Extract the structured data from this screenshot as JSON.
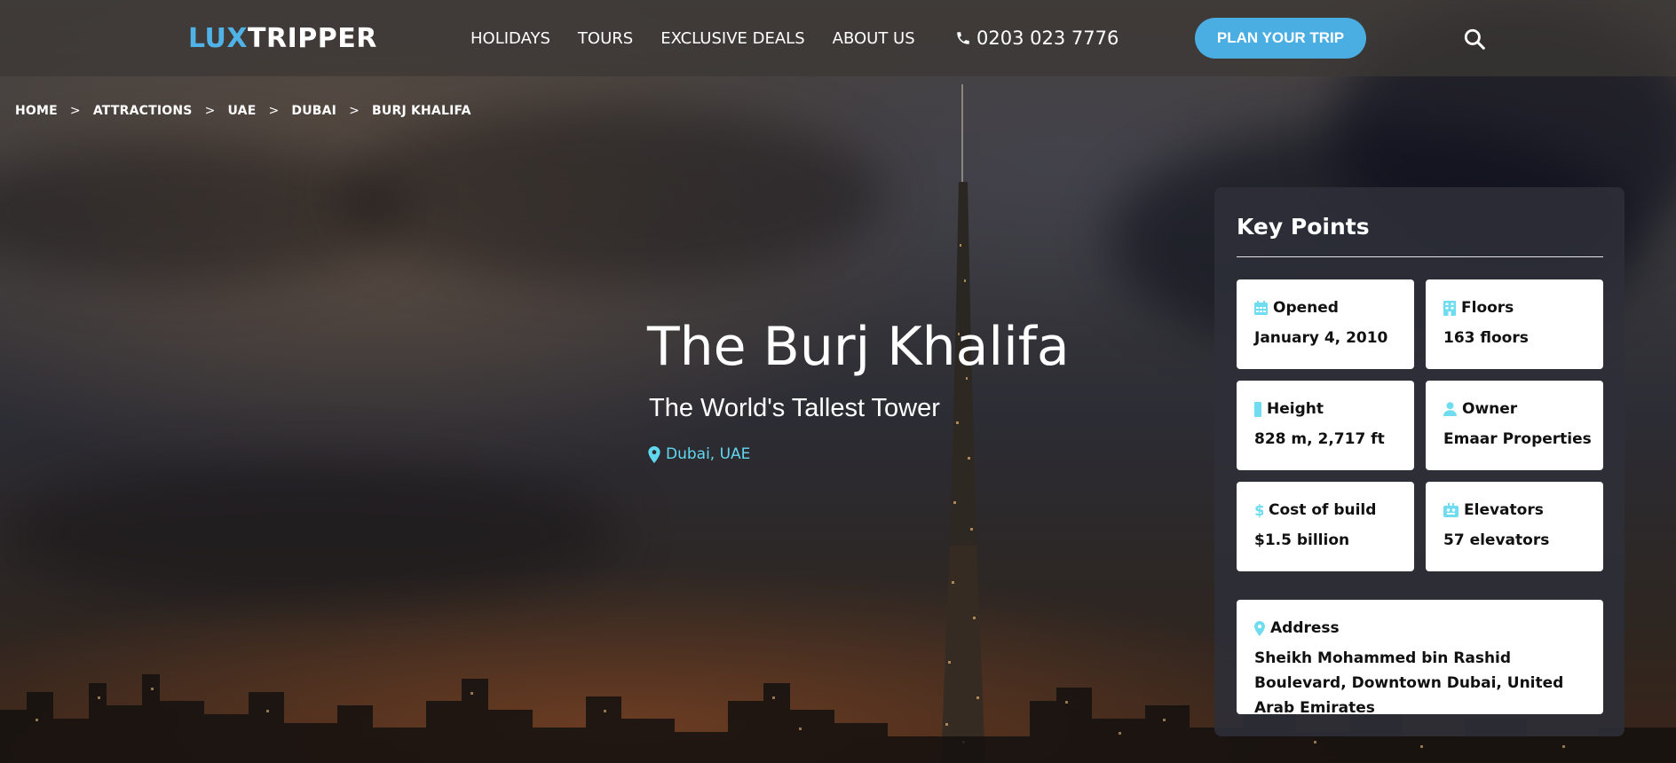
{
  "header": {
    "logo_lux": "LUX",
    "logo_tripper": "TRIPPER",
    "nav": [
      "HOLIDAYS",
      "TOURS",
      "EXCLUSIVE DEALS",
      "ABOUT US"
    ],
    "phone": "0203 023 7776",
    "cta": "PLAN YOUR TRIP",
    "accent_color": "#4aaee2"
  },
  "breadcrumb": [
    "HOME",
    "ATTRACTIONS",
    "UAE",
    "DUBAI",
    "BURJ KHALIFA"
  ],
  "breadcrumb_separator": ">",
  "hero": {
    "title": "The Burj Khalifa",
    "subtitle": "The World's Tallest Tower",
    "location": "Dubai, UAE",
    "location_color": "#61d8f0"
  },
  "key_points": {
    "title": "Key Points",
    "opened": {
      "label": "Opened",
      "value": "January 4, 2010",
      "icon": "calendar-icon"
    },
    "floors": {
      "label": "Floors",
      "value": "163 floors",
      "icon": "building-icon"
    },
    "height": {
      "label": "Height",
      "value": "828 m, 2,717 ft",
      "icon": "height-bar-icon"
    },
    "owner": {
      "label": "Owner",
      "value": "Emaar Properties",
      "icon": "user-icon"
    },
    "cost": {
      "label": "Cost of build",
      "value": "$1.5 billion",
      "icon": "dollar-icon"
    },
    "elevators": {
      "label": "Elevators",
      "value": "57 elevators",
      "icon": "elevator-icon"
    },
    "address": {
      "label": "Address",
      "value": "Sheikh Mohammed bin Rashid Boulevard, Downtown Dubai, United Arab Emirates",
      "icon": "map-pin-icon"
    },
    "icon_color": "#6fdcef"
  }
}
